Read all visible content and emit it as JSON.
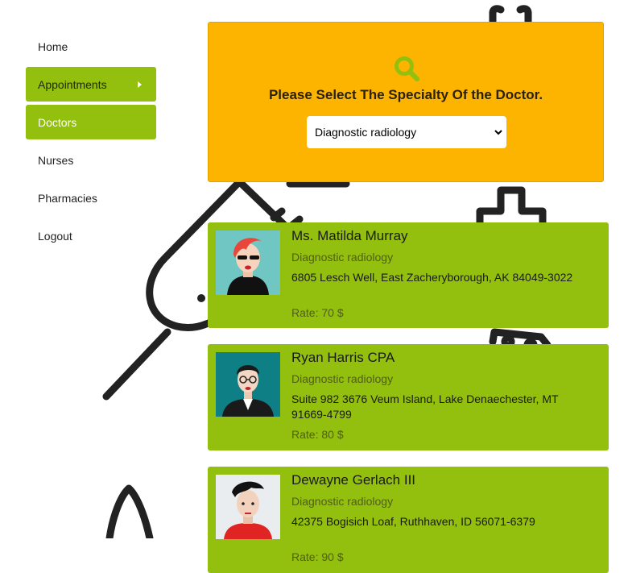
{
  "sidebar": {
    "items": [
      {
        "label": "Home"
      },
      {
        "label": "Appointments"
      },
      {
        "label": "Doctors"
      },
      {
        "label": "Nurses"
      },
      {
        "label": "Pharmacies"
      },
      {
        "label": "Logout"
      }
    ]
  },
  "search": {
    "icon": "search-icon",
    "title": "Please Select The Specialty Of the Doctor.",
    "selected": "Diagnostic radiology"
  },
  "doctors": [
    {
      "name": "Ms. Matilda Murray",
      "specialty": "Diagnostic radiology",
      "address": "6805 Lesch Well, East Zacheryborough, AK 84049-3022",
      "rate": "Rate: 70 $"
    },
    {
      "name": "Ryan Harris CPA",
      "specialty": "Diagnostic radiology",
      "address": "Suite 982 3676 Veum Island, Lake Denaechester, MT 91669-4799",
      "rate": "Rate: 80 $"
    },
    {
      "name": "Dewayne Gerlach III",
      "specialty": "Diagnostic radiology",
      "address": "42375 Bogisich Loaf, Ruthhaven, ID 56071-6379",
      "rate": "Rate: 90 $"
    }
  ],
  "colors": {
    "accent_green": "#93bf0e",
    "search_yellow": "#fdb400"
  }
}
